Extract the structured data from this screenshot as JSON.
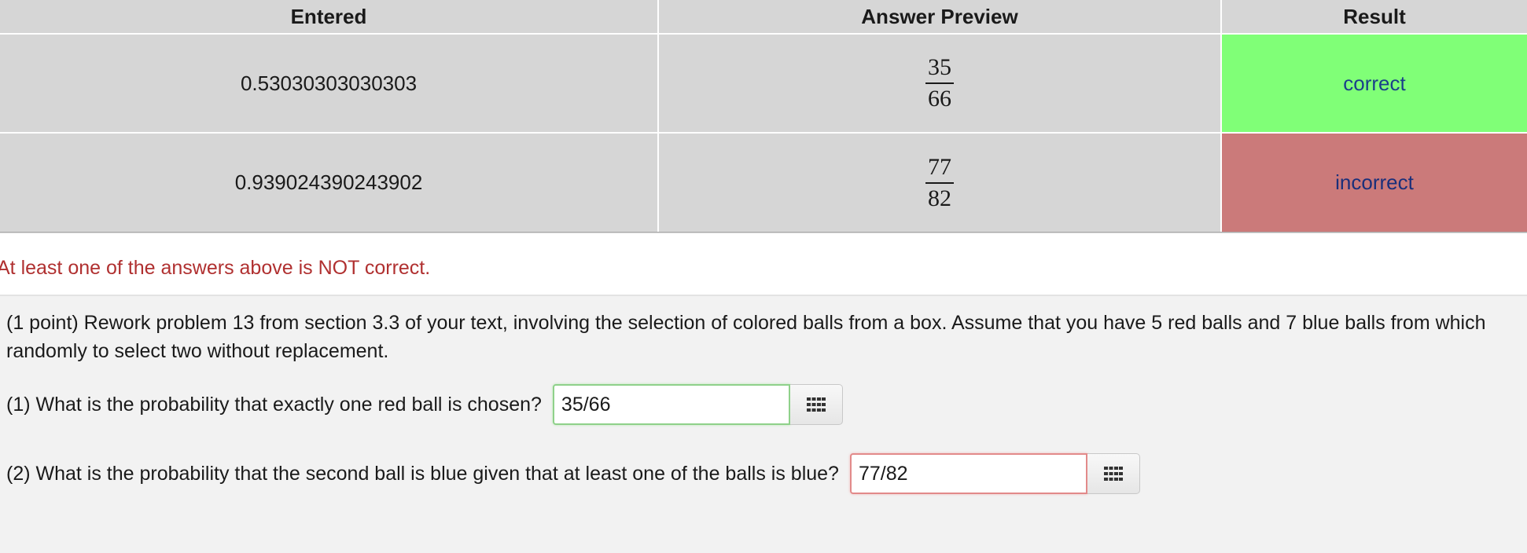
{
  "table": {
    "headers": [
      "Entered",
      "Answer Preview",
      "Result"
    ],
    "rows": [
      {
        "entered": "0.53030303030303",
        "preview_num": "35",
        "preview_den": "66",
        "result": "correct",
        "status": "correct"
      },
      {
        "entered": "0.939024390243902",
        "preview_num": "77",
        "preview_den": "82",
        "result": "incorrect",
        "status": "incorrect"
      }
    ]
  },
  "message": "At least one of the answers above is NOT correct.",
  "problem": {
    "intro": "(1 point) Rework problem 13 from section 3.3 of your text, involving the selection of colored balls from a box. Assume that you have 5 red balls and 7 blue balls from which randomly to select two without replacement.",
    "questions": [
      {
        "text": "(1) What is the probability that exactly one red ball is chosen?",
        "value": "35/66",
        "status": "correct"
      },
      {
        "text": "(2) What is the probability that the second ball is blue given that at least one of the balls is blue?",
        "value": "77/82",
        "status": "incorrect"
      }
    ]
  },
  "colors": {
    "correct": "#80ff77",
    "incorrect": "#cb7a7a",
    "message": "#b03030"
  },
  "icons": {
    "equation_editor": "keypad-grid-icon"
  }
}
